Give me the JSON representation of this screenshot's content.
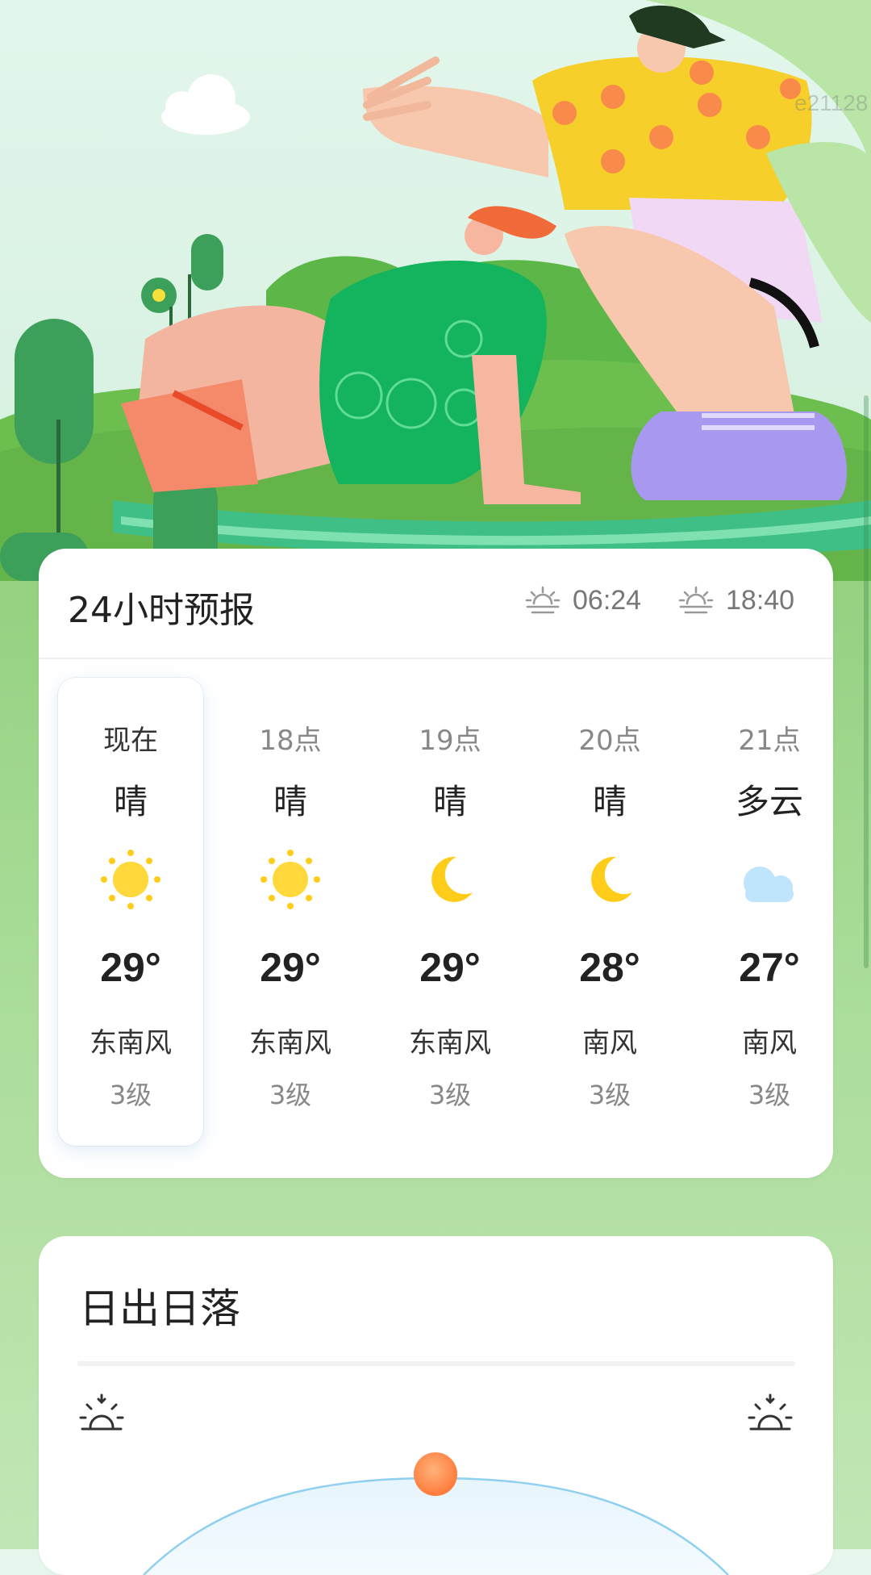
{
  "hero": {
    "watermark": "e21128"
  },
  "forecast": {
    "title": "24小时预报",
    "sunrise": "06:24",
    "sunset": "18:40",
    "hours": [
      {
        "time": "现在",
        "condition": "晴",
        "icon": "sun-icon",
        "temp": "29°",
        "wind": "东南风",
        "level": "3级",
        "current": true
      },
      {
        "time": "18点",
        "condition": "晴",
        "icon": "sun-icon",
        "temp": "29°",
        "wind": "东南风",
        "level": "3级"
      },
      {
        "time": "19点",
        "condition": "晴",
        "icon": "moon-icon",
        "temp": "29°",
        "wind": "东南风",
        "level": "3级"
      },
      {
        "time": "20点",
        "condition": "晴",
        "icon": "moon-icon",
        "temp": "28°",
        "wind": "南风",
        "level": "3级"
      },
      {
        "time": "21点",
        "condition": "多云",
        "icon": "cloudy-night-icon",
        "temp": "27°",
        "wind": "南风",
        "level": "3级"
      }
    ]
  },
  "sun": {
    "title": "日出日落"
  },
  "colors": {
    "card": "#ffffff",
    "sun": "#ffcc1a",
    "arc": "#8fd0f0",
    "sun_ball": "#ff8a4c"
  }
}
